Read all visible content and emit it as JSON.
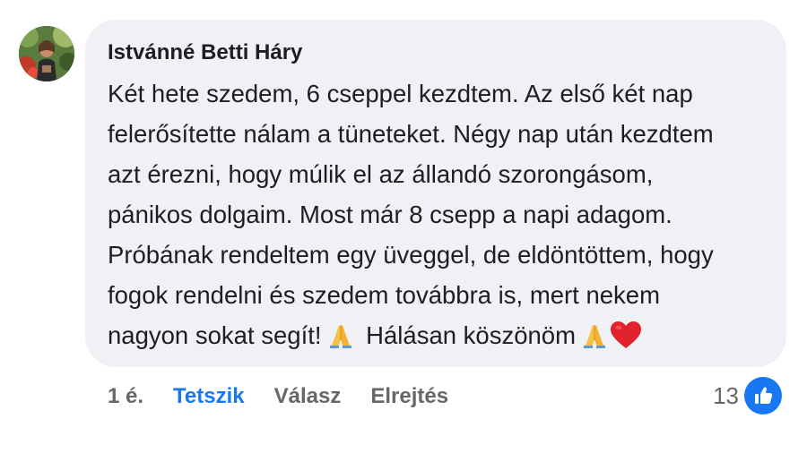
{
  "comment": {
    "author": "Istvánné Betti Háry",
    "lines": [
      "Két hete szedem, 6 cseppel kezdtem. Az első két nap",
      "felerősítette nálam a tüneteket. Négy nap után kezdtem",
      "azt érezni, hogy múlik el az állandó szorongásom,",
      "pánikos dolgaim. Most már 8 csepp a napi adagom.",
      "Próbának rendeltem egy üveggel, de eldöntöttem, hogy",
      "fogok rendelni és szedem továbbra is, mert nekem"
    ],
    "last_line_part1": "nagyon sokat segít!",
    "last_line_part2": "Hálásan köszönöm",
    "emojis": [
      "folded-hands",
      "folded-hands",
      "red-heart"
    ]
  },
  "actions": {
    "timestamp": "1 é.",
    "like_label": "Tetszik",
    "reply_label": "Válasz",
    "hide_label": "Elrejtés"
  },
  "reactions": {
    "count": "13",
    "icon": "thumbs-up-icon"
  },
  "colors": {
    "bubble": "#f0f1f5",
    "like_blue": "#1877f2",
    "secondary_text": "#65676b",
    "primary_text": "#1c1e21"
  }
}
